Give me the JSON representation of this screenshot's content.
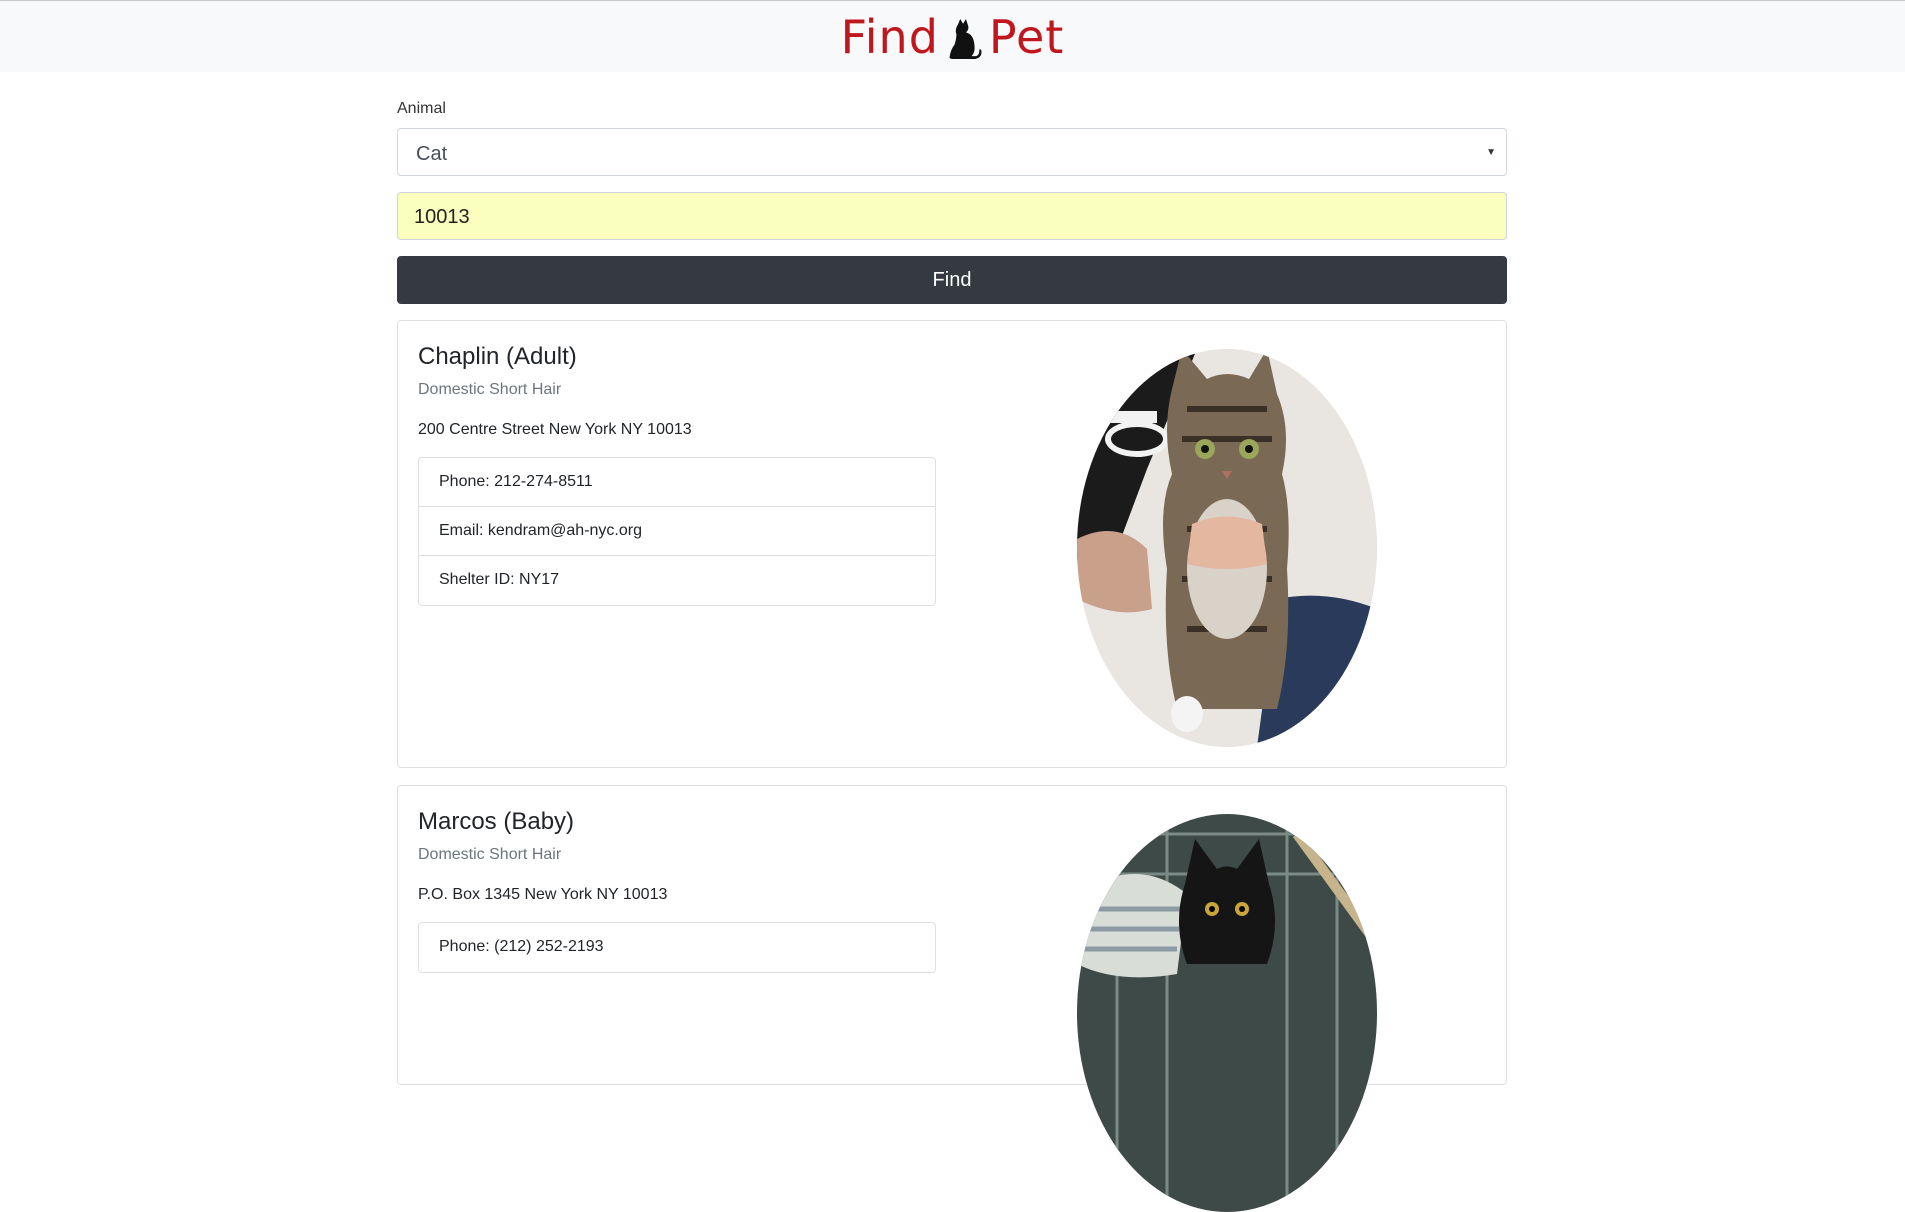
{
  "header": {
    "logo_word_1": "Find",
    "logo_word_2": "Pet",
    "logo_icon": "cat-silhouette-icon",
    "logo_color": "#c0161d"
  },
  "form": {
    "animal_label": "Animal",
    "animal_selected": "Cat",
    "zip_value": "10013",
    "find_label": "Find"
  },
  "pets": [
    {
      "name": "Chaplin (Adult)",
      "breed": "Domestic Short Hair",
      "address": "200 Centre Street New York NY 10013",
      "phone": "Phone: 212-274-8511",
      "email": "Email: kendram@ah-nyc.org",
      "shelter": "Shelter ID: NY17",
      "photo_icon": "tabby-cat-photo"
    },
    {
      "name": "Marcos (Baby)",
      "breed": "Domestic Short Hair",
      "address": "P.O. Box 1345 New York NY 10013",
      "phone": "Phone: (212) 252-2193",
      "photo_icon": "black-kitten-photo"
    }
  ]
}
